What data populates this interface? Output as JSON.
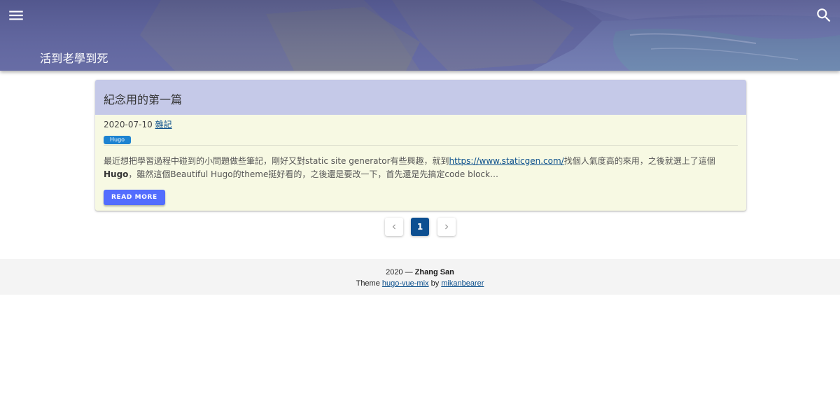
{
  "header": {
    "site_title": "活到老學到死",
    "menu_icon": "menu-icon",
    "search_icon": "search-icon"
  },
  "post": {
    "title": "紀念用的第一篇",
    "date": "2020-07-10",
    "category": "雜記",
    "tag": "Hugo",
    "excerpt_part1": "最近想把學習過程中碰到的小問題做些筆記，剛好又對static site generator有些興趣，就到",
    "excerpt_link": "https://www.staticgen.com/",
    "excerpt_part2": "找個人氣度高的來用，之後就選上了這個",
    "excerpt_bold": "Hugo",
    "excerpt_part3": "，雖然這個Beautiful Hugo的theme挺好看的，之後還是要改一下，首先還是先搞定code block…",
    "read_more": "READ MORE"
  },
  "pagination": {
    "current_page": "1",
    "prev_icon": "chevron-left-icon",
    "next_icon": "chevron-right-icon"
  },
  "footer": {
    "year_prefix": "2020 — ",
    "author": "Zhang San",
    "theme_prefix": "Theme ",
    "theme_name": "hugo-vue-mix",
    "by_text": " by ",
    "theme_author": "mikanbearer"
  },
  "colors": {
    "card_header": "#c5c9e8",
    "card_body": "#f7f9e3",
    "accent_button": "#536dfe",
    "tag": "#1d83d1",
    "active_page": "#0d4f91"
  }
}
